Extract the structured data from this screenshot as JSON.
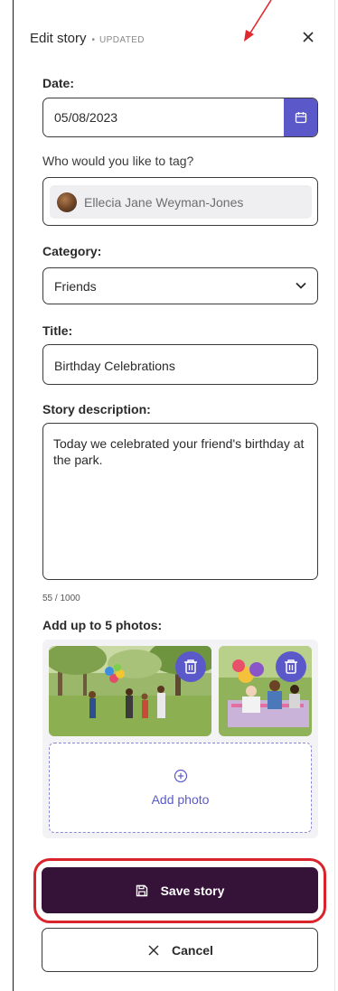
{
  "header": {
    "title": "Edit story",
    "separator": "•",
    "status": "UPDATED",
    "close_icon": "close-icon"
  },
  "date": {
    "label": "Date:",
    "value": "05/08/2023",
    "icon": "calendar-icon"
  },
  "tag": {
    "label": "Who would you like to tag?",
    "person_name": "Ellecia Jane Weyman-Jones"
  },
  "category": {
    "label": "Category:",
    "selected": "Friends",
    "icon": "chevron-down-icon"
  },
  "title_field": {
    "label": "Title:",
    "value": "Birthday Celebrations"
  },
  "description": {
    "label": "Story description:",
    "value": "Today we celebrated your friend's birthday at the park.",
    "counter": "55 / 1000"
  },
  "photos": {
    "label": "Add up to 5 photos:",
    "delete_icon": "trash-icon",
    "add_label": "Add photo",
    "add_icon": "plus-circle-icon"
  },
  "actions": {
    "save_label": "Save story",
    "save_icon": "save-icon",
    "cancel_label": "Cancel",
    "cancel_icon": "close-icon"
  },
  "colors": {
    "accent": "#5b59c9",
    "save_button": "#351237",
    "highlight": "#d9242c",
    "annotation_arrow": "#e0282f"
  }
}
